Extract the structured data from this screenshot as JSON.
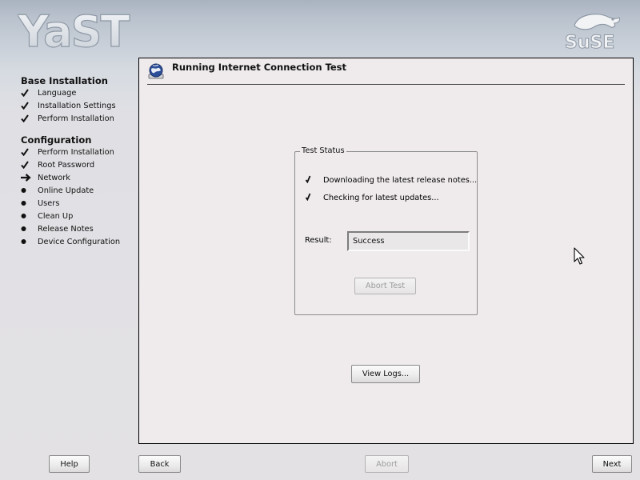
{
  "header": {
    "yast_logo_text": "YaST",
    "suse_logo_text": "SuSE"
  },
  "sidebar": {
    "sections": [
      {
        "title": "Base Installation",
        "items": [
          {
            "label": "Language",
            "status": "done"
          },
          {
            "label": "Installation Settings",
            "status": "done"
          },
          {
            "label": "Perform Installation",
            "status": "done"
          }
        ]
      },
      {
        "title": "Configuration",
        "items": [
          {
            "label": "Perform Installation",
            "status": "done"
          },
          {
            "label": "Root Password",
            "status": "done"
          },
          {
            "label": "Network",
            "status": "current"
          },
          {
            "label": "Online Update",
            "status": "pending"
          },
          {
            "label": "Users",
            "status": "pending"
          },
          {
            "label": "Clean Up",
            "status": "pending"
          },
          {
            "label": "Release Notes",
            "status": "pending"
          },
          {
            "label": "Device Configuration",
            "status": "pending"
          }
        ]
      }
    ]
  },
  "dialog": {
    "title": "Running Internet Connection Test",
    "test_status": {
      "legend": "Test Status",
      "steps": [
        {
          "label": "Downloading the latest release notes..."
        },
        {
          "label": "Checking for latest updates..."
        }
      ],
      "result_label": "Result:",
      "result_value": "Success",
      "abort_test_label": "Abort Test"
    },
    "view_logs_label": "View Logs..."
  },
  "footer": {
    "help_label": "Help",
    "back_label": "Back",
    "abort_label": "Abort",
    "next_label": "Next"
  },
  "colors": {
    "panel_background": "#efebec",
    "desktop_background": "#e3e1e3",
    "disabled_text": "#9c9c9c"
  }
}
